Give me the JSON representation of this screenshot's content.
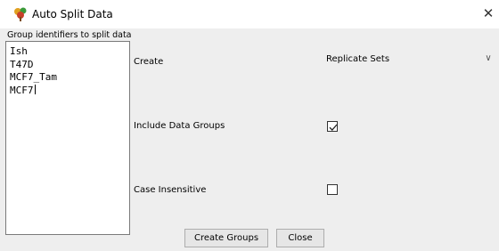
{
  "window": {
    "title": "Auto Split Data",
    "close_glyph": "✕",
    "icon": "tree-icon"
  },
  "group_identifiers": {
    "label": "Group identifiers to split data",
    "lines": [
      "Ish",
      "T47D",
      "MCF7_Tam",
      "MCF7"
    ]
  },
  "create": {
    "label": "Create",
    "selected": "Replicate Sets",
    "chevron_glyph": "∨"
  },
  "include_data_groups": {
    "label": "Include Data Groups",
    "checked": true
  },
  "case_insensitive": {
    "label": "Case Insensitive",
    "checked": false
  },
  "buttons": {
    "create_groups": "Create Groups",
    "close": "Close"
  }
}
